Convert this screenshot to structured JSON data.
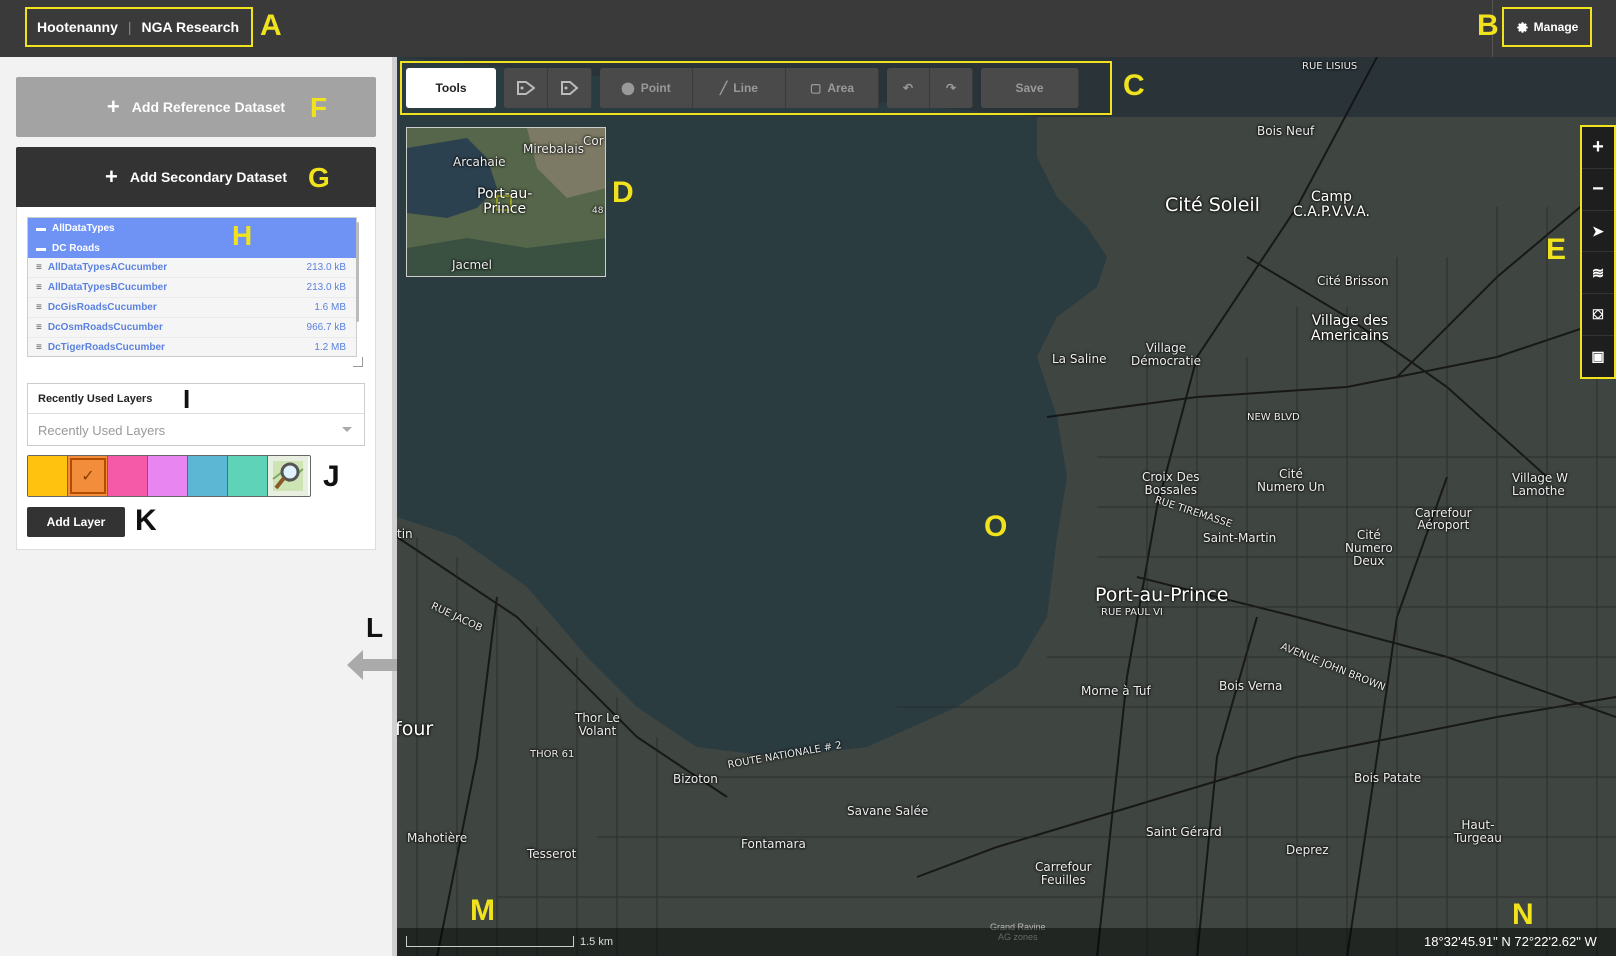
{
  "header": {
    "app_name": "Hootenanny",
    "project_name": "NGA Research",
    "manage_label": "Manage"
  },
  "sidebar": {
    "add_reference_label": "Add Reference Dataset",
    "add_secondary_label": "Add Secondary Dataset",
    "tree": {
      "folders": [
        {
          "label": "AllDataTypes"
        },
        {
          "label": "DC Roads"
        }
      ],
      "files": [
        {
          "label": "AllDataTypesACucumber",
          "size": "213.0 kB"
        },
        {
          "label": "AllDataTypesBCucumber",
          "size": "213.0 kB"
        },
        {
          "label": "DcGisRoadsCucumber",
          "size": "1.6 MB"
        },
        {
          "label": "DcOsmRoadsCucumber",
          "size": "966.7 kB"
        },
        {
          "label": "DcTigerRoadsCucumber",
          "size": "1.2 MB"
        }
      ]
    },
    "recent_title": "Recently Used Layers",
    "recent_placeholder": "Recently Used Layers",
    "palette": [
      {
        "color": "#ffc20e",
        "selected": false
      },
      {
        "color": "#f28d3c",
        "selected": true
      },
      {
        "color": "#f45aa8",
        "selected": false
      },
      {
        "color": "#e985f0",
        "selected": false
      },
      {
        "color": "#5bb7d4",
        "selected": false
      },
      {
        "color": "#5fd3b7",
        "selected": false
      }
    ],
    "palette_osm_icon": "osm-magnifier-icon",
    "add_layer_label": "Add Layer"
  },
  "toolbar": {
    "tools_label": "Tools",
    "point_label": "Point",
    "line_label": "Line",
    "area_label": "Area",
    "save_label": "Save"
  },
  "minimap": {
    "labels": [
      {
        "text": "Mirebalais"
      },
      {
        "text": "Arcahaie"
      },
      {
        "text": "Cor"
      },
      {
        "text": "Port-au-\nPrince"
      },
      {
        "text": "Jacmel"
      },
      {
        "text": "48"
      }
    ]
  },
  "map": {
    "labels": [
      {
        "text": "Cité Soleil"
      },
      {
        "text": "Camp\nC.A.P.V.V.A."
      },
      {
        "text": "Bois Neuf"
      },
      {
        "text": "Cité Brisson"
      },
      {
        "text": "Village des\nAmericains"
      },
      {
        "text": "Village\nDémocratie"
      },
      {
        "text": "La Saline"
      },
      {
        "text": "NEW BLVD"
      },
      {
        "text": "Croix Des\nBossales"
      },
      {
        "text": "Cité\nNumero Un"
      },
      {
        "text": "Saint-Martin"
      },
      {
        "text": "RUE TIREMASSE"
      },
      {
        "text": "Cité\nNumero\nDeux"
      },
      {
        "text": "Carrefour\nAéroport"
      },
      {
        "text": "Village W\nLamothe"
      },
      {
        "text": "Port-au-Prince"
      },
      {
        "text": "RUE PAUL VI"
      },
      {
        "text": "Morne à Tuf"
      },
      {
        "text": "Bois Verna"
      },
      {
        "text": "AVENUE JOHN BROWN"
      },
      {
        "text": "RUE JACOB"
      },
      {
        "text": "Thor Le\nVolant"
      },
      {
        "text": "THOR 61"
      },
      {
        "text": "ROUTE NATIONALE # 2"
      },
      {
        "text": "four"
      },
      {
        "text": "Bizoton"
      },
      {
        "text": "Savane Salée"
      },
      {
        "text": "Saint Gérard"
      },
      {
        "text": "Bois Patate"
      },
      {
        "text": "Haut-\nTurgeau"
      },
      {
        "text": "Deprez"
      },
      {
        "text": "Mahotière"
      },
      {
        "text": "Tesserot"
      },
      {
        "text": "Fontamara"
      },
      {
        "text": "Carrefour\nFeuilles"
      },
      {
        "text": "RUE LISIUS"
      },
      {
        "text": "tin"
      }
    ],
    "attribution": "Grand Ravine\nAG zones",
    "scale_label": "1.5 km",
    "coordinates": "18°32'45.91\" N 72°22'2.62\" W"
  },
  "annotations": [
    "A",
    "B",
    "C",
    "D",
    "E",
    "F",
    "G",
    "H",
    "I",
    "J",
    "K",
    "L",
    "M",
    "N",
    "O"
  ]
}
